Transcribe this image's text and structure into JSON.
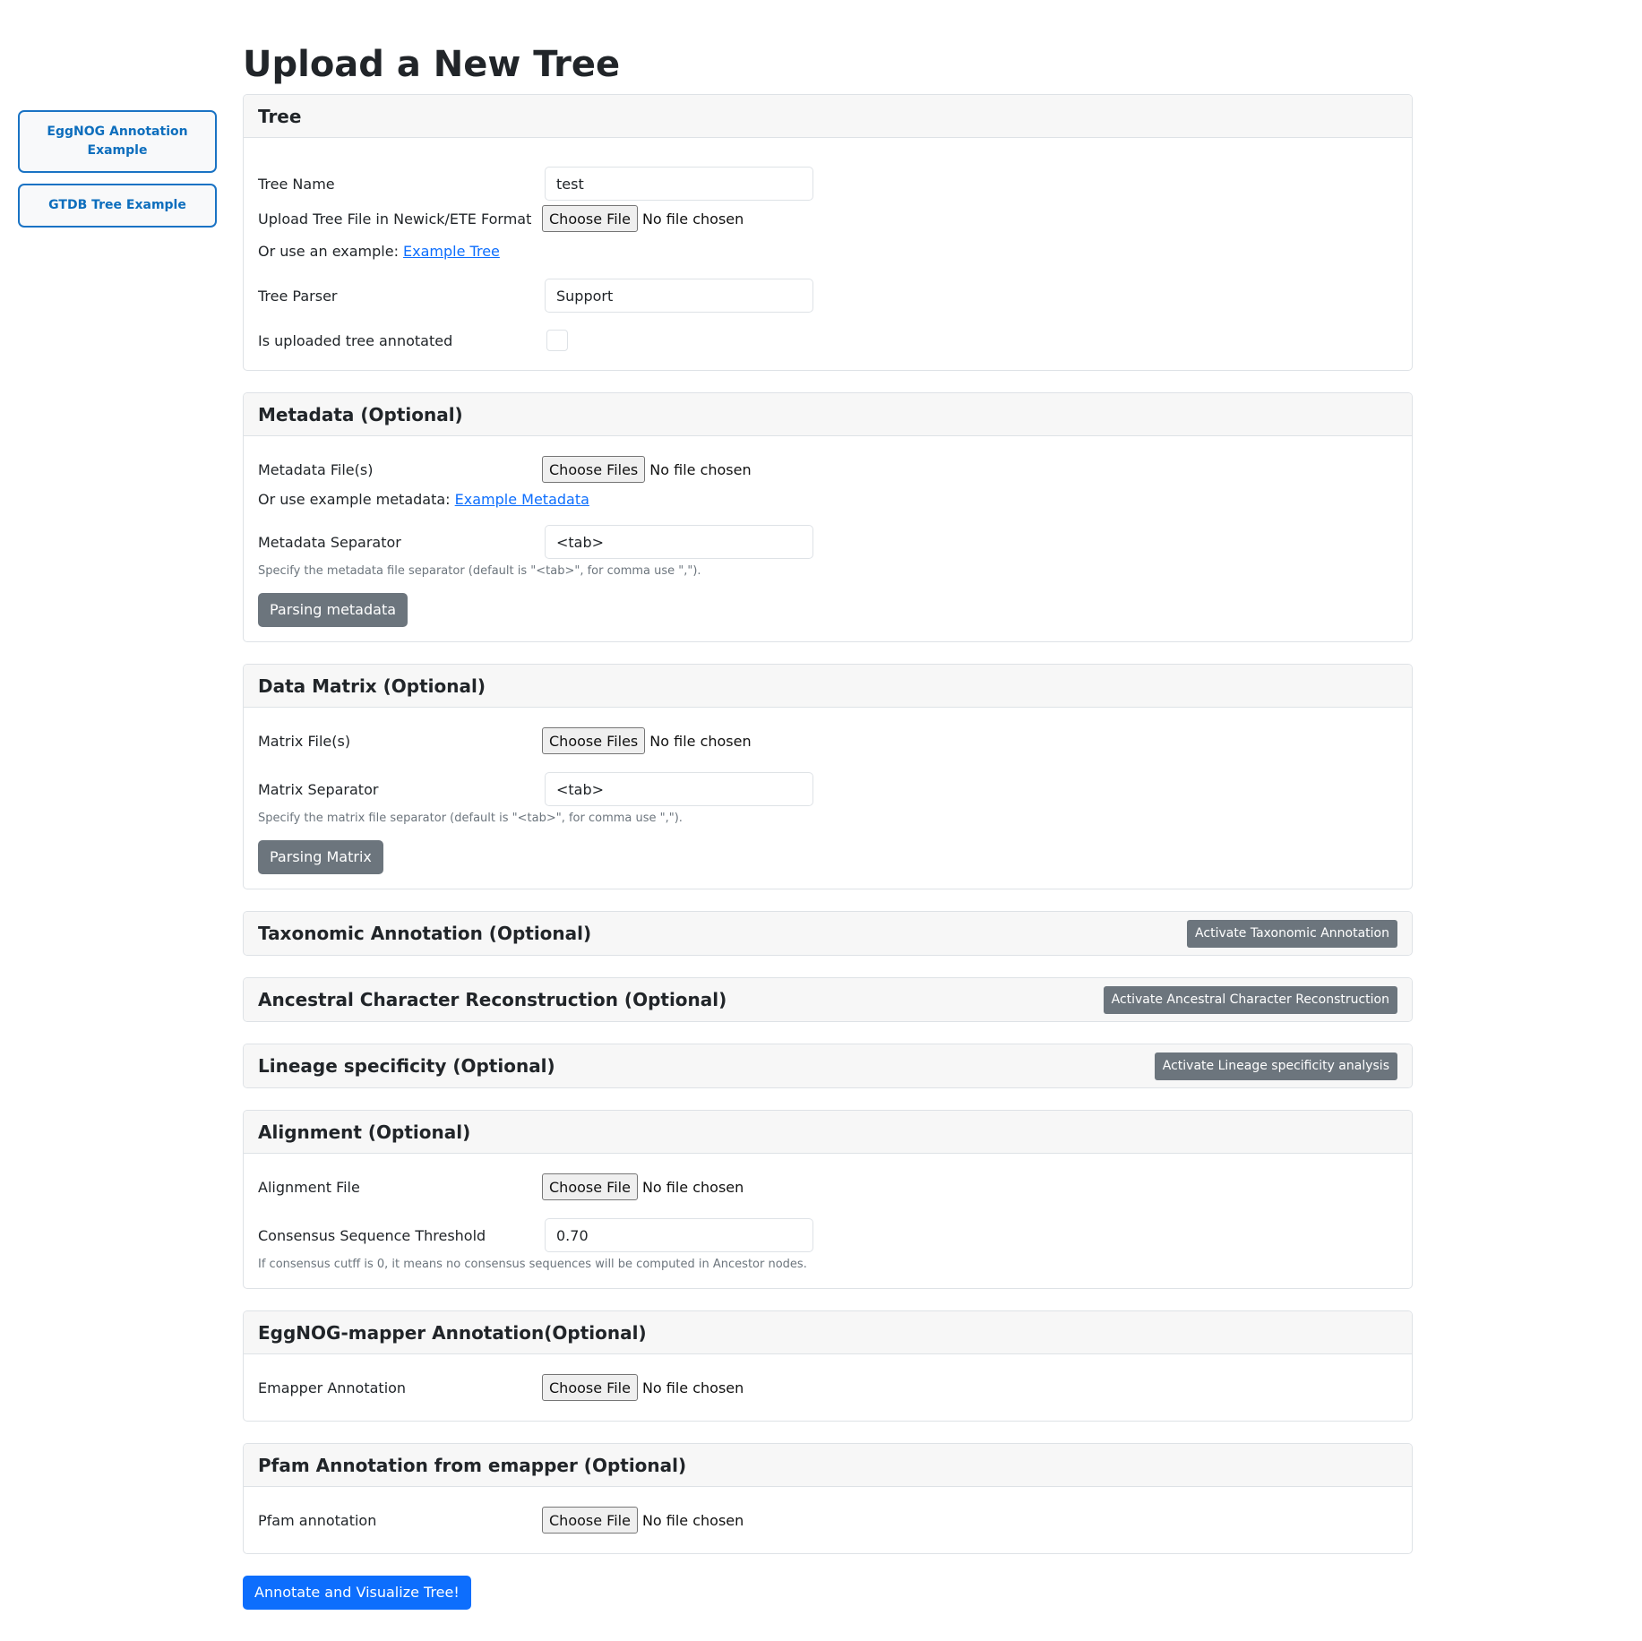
{
  "sidebar": {
    "eggnog_example": "EggNOG Annotation Example",
    "gtdb_example": "GTDB Tree Example"
  },
  "page": {
    "title": "Upload a New Tree"
  },
  "tree": {
    "header": "Tree",
    "tree_name_label": "Tree Name",
    "tree_name_value": "test",
    "upload_label": "Upload Tree File in Newick/ETE Format",
    "choose_file": "Choose File",
    "no_file": "No file chosen",
    "example_prefix": "Or use an example: ",
    "example_link": "Example Tree",
    "parser_label": "Tree Parser",
    "parser_value": "Support",
    "annotated_label": "Is uploaded tree annotated",
    "annotated_checked": false
  },
  "metadata": {
    "header": "Metadata (Optional)",
    "files_label": "Metadata File(s)",
    "choose_files": "Choose Files",
    "no_file": "No file chosen",
    "example_prefix": "Or use example metadata: ",
    "example_link": "Example Metadata",
    "separator_label": "Metadata Separator",
    "separator_value": "<tab>",
    "help": "Specify the metadata file separator (default is \"<tab>\", for comma use \",\").",
    "parse_button": "Parsing metadata"
  },
  "matrix": {
    "header": "Data Matrix (Optional)",
    "files_label": "Matrix File(s)",
    "choose_files": "Choose Files",
    "no_file": "No file chosen",
    "separator_label": "Matrix Separator",
    "separator_value": "<tab>",
    "help": "Specify the matrix file separator (default is \"<tab>\", for comma use \",\").",
    "parse_button": "Parsing Matrix"
  },
  "taxonomic": {
    "header": "Taxonomic Annotation (Optional)",
    "activate_button": "Activate Taxonomic Annotation"
  },
  "ancestral": {
    "header": "Ancestral Character Reconstruction (Optional)",
    "activate_button": "Activate Ancestral Character Reconstruction"
  },
  "lineage": {
    "header": "Lineage specificity (Optional)",
    "activate_button": "Activate Lineage specificity analysis"
  },
  "alignment": {
    "header": "Alignment (Optional)",
    "file_label": "Alignment File",
    "choose_file": "Choose File",
    "no_file": "No file chosen",
    "threshold_label": "Consensus Sequence Threshold",
    "threshold_value": "0.70",
    "help": "If consensus cutff is 0, it means no consensus sequences will be computed in Ancestor nodes."
  },
  "emapper": {
    "header": "EggNOG-mapper Annotation(Optional)",
    "file_label": "Emapper Annotation",
    "choose_file": "Choose File",
    "no_file": "No file chosen"
  },
  "pfam": {
    "header": "Pfam Annotation from emapper (Optional)",
    "file_label": "Pfam annotation",
    "choose_file": "Choose File",
    "no_file": "No file chosen"
  },
  "submit": {
    "label": "Annotate and Visualize Tree!"
  }
}
